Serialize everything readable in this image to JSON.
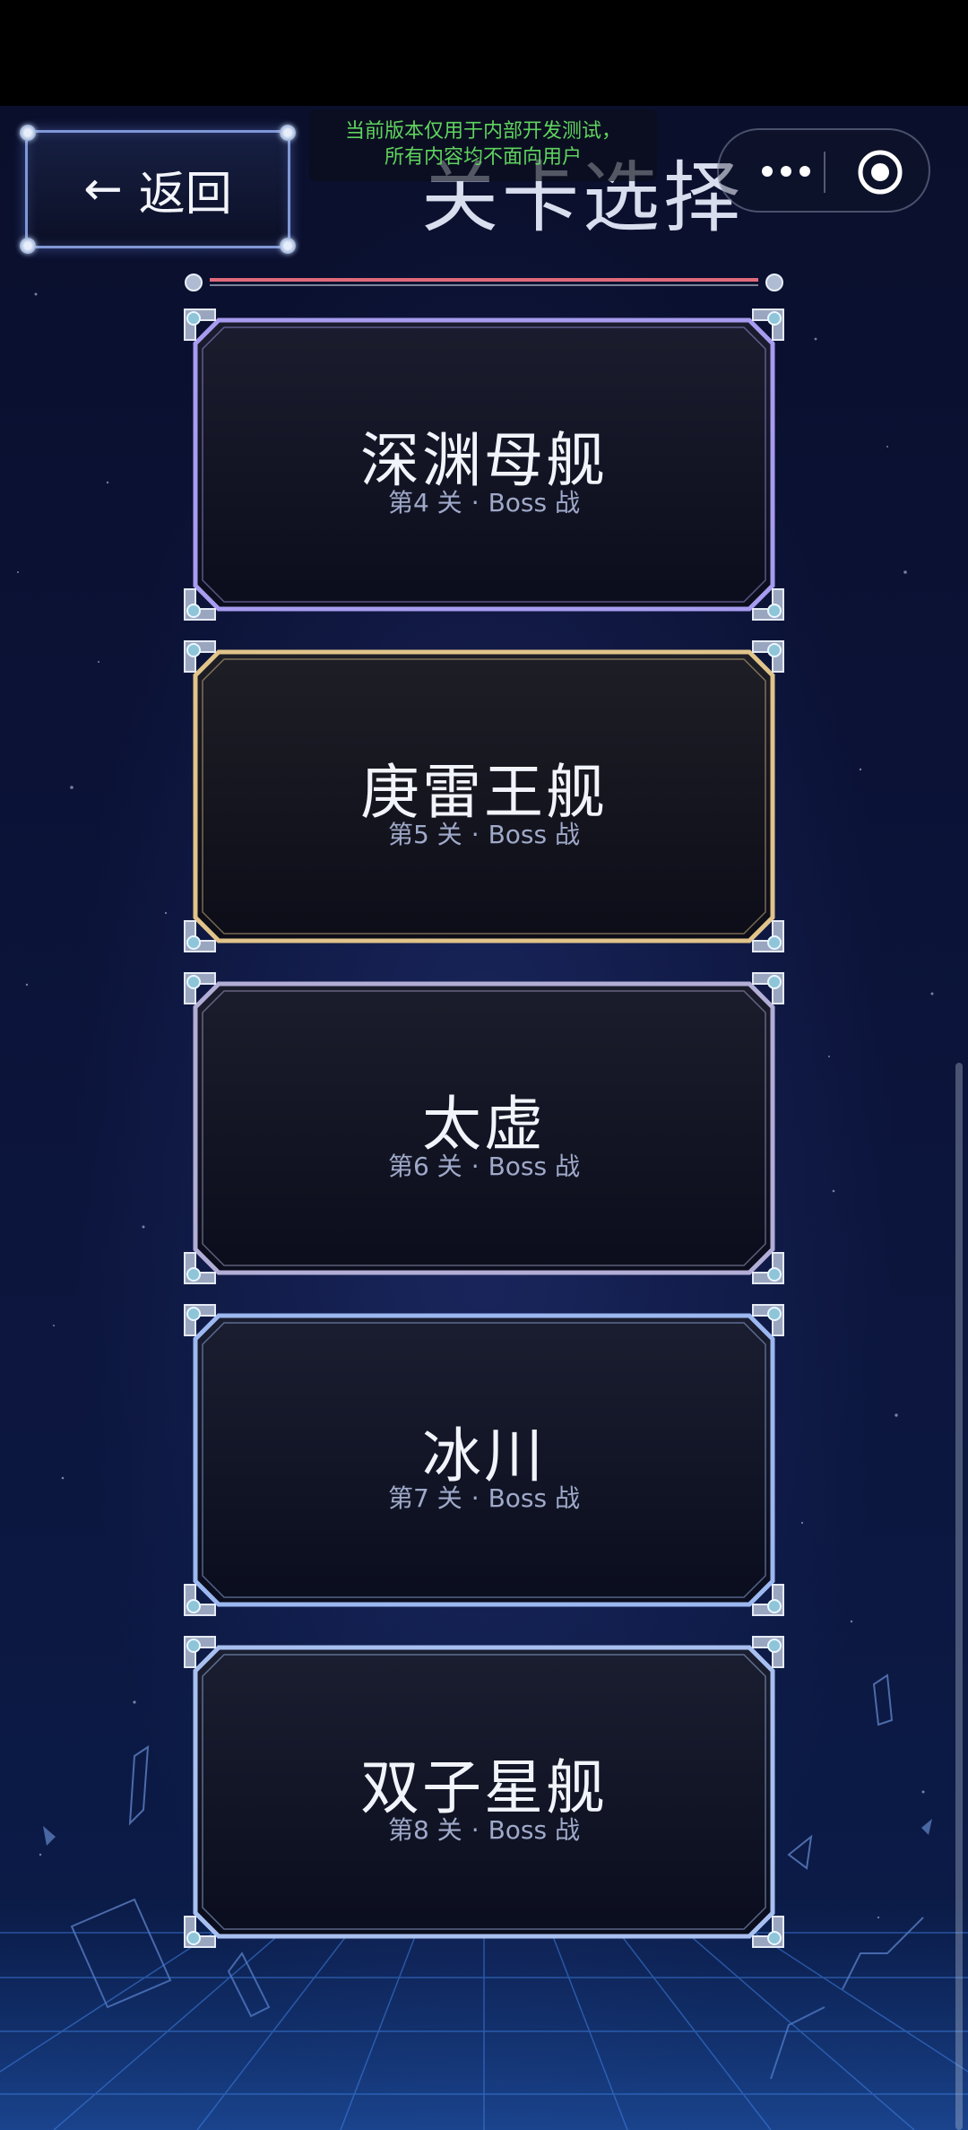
{
  "header": {
    "back_label": "返回",
    "title": "关卡选择",
    "notice_line1": "当前版本仅用于内部开发测试，",
    "notice_line2": "所有内容均不面向用户"
  },
  "levels": [
    {
      "name": "深渊母舰",
      "stage": "第4 关",
      "type": "Boss 战",
      "accent": "#a79cf0"
    },
    {
      "name": "庚雷王舰",
      "stage": "第5 关",
      "type": "Boss 战",
      "accent": "#e1c48a"
    },
    {
      "name": "太虚",
      "stage": "第6 关",
      "type": "Boss 战",
      "accent": "#b3aed6"
    },
    {
      "name": "冰川",
      "stage": "第7 关",
      "type": "Boss 战",
      "accent": "#9cb8f0"
    },
    {
      "name": "双子星舰",
      "stage": "第8 关",
      "type": "Boss 战",
      "accent": "#a8c0f0"
    }
  ],
  "separator": "·",
  "colors": {
    "top_strip": "#e06a7a",
    "notice_text": "#5fd35f",
    "background": "#0b1236"
  },
  "icons": {
    "back": "arrow-left-icon",
    "more": "more-dots-icon",
    "close": "record-close-icon"
  }
}
